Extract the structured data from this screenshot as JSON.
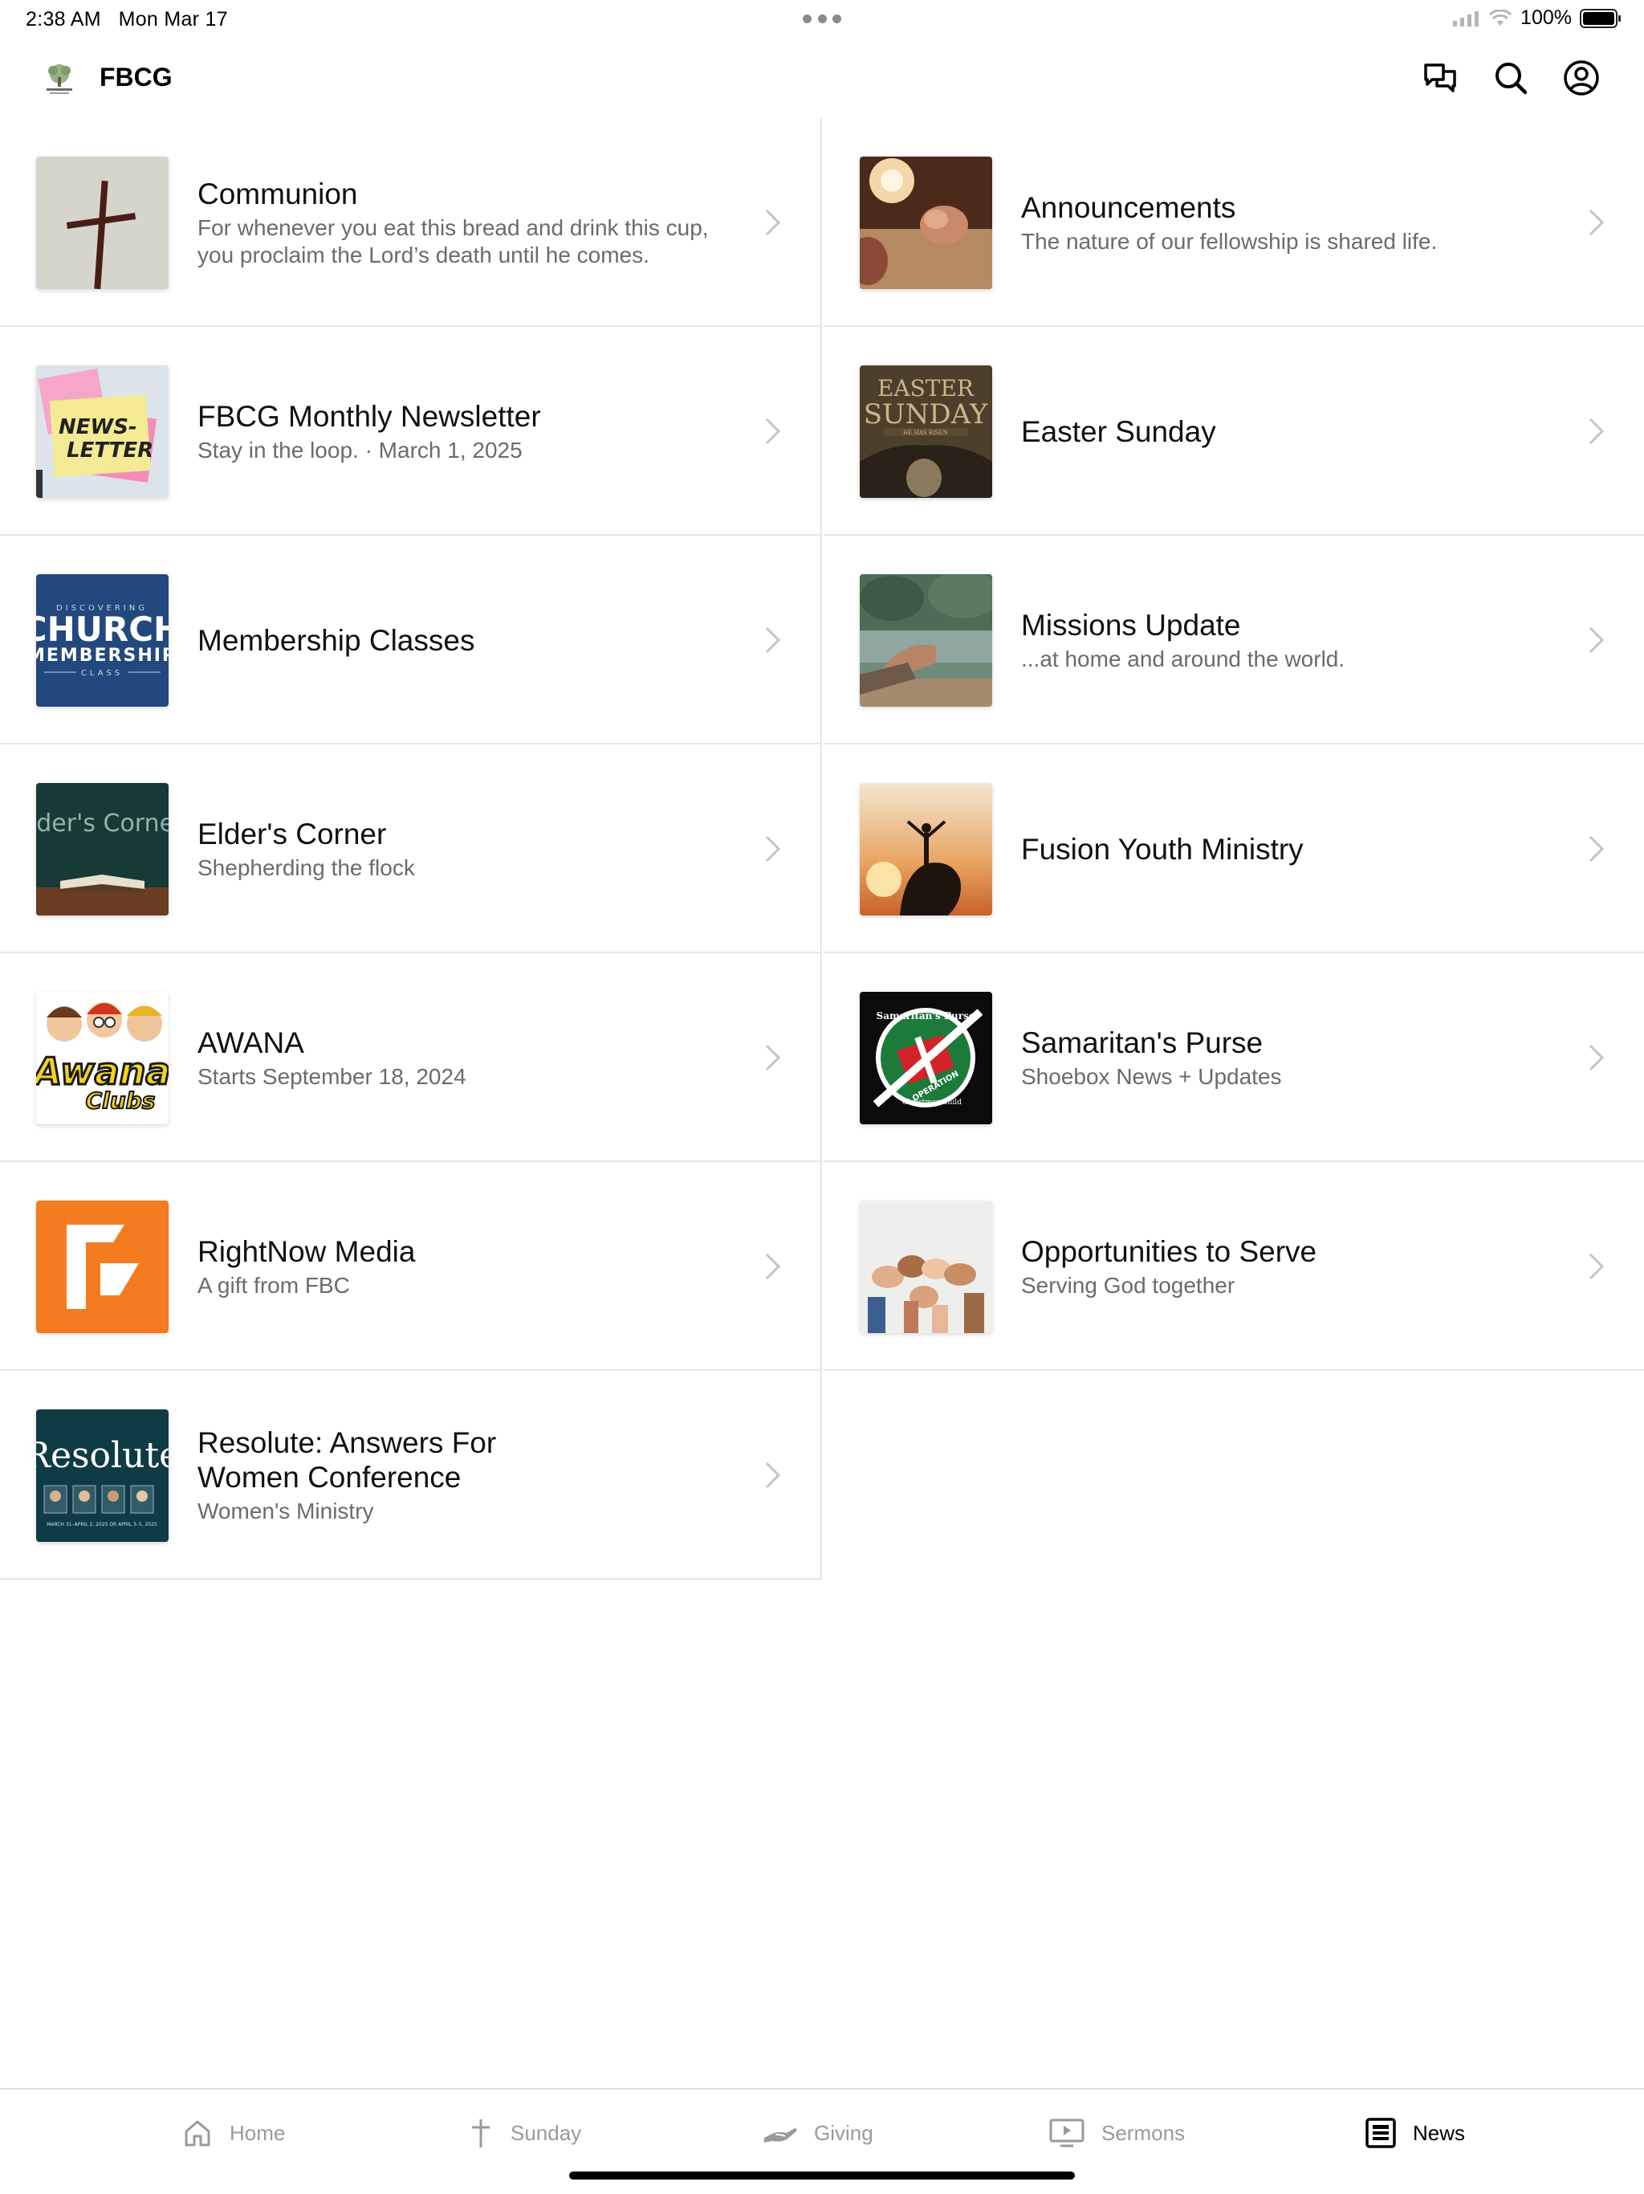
{
  "status_bar": {
    "time": "2:38 AM",
    "date": "Mon Mar 17",
    "battery": "100%",
    "icons": [
      "signal-icon",
      "wifi-icon",
      "battery-icon"
    ]
  },
  "header": {
    "title": "FBCG",
    "logo_icon": "church-logo-icon",
    "actions": [
      "chat-icon",
      "search-icon",
      "account-icon"
    ]
  },
  "news": {
    "items": [
      {
        "title": "Communion",
        "subtitle": "For whenever you eat this bread and drink this cup, you proclaim the Lord’s death until he comes.",
        "thumb": "cross-image"
      },
      {
        "title": "Announcements",
        "subtitle": "The nature of our fellowship is shared life.",
        "thumb": "praying-hands-image"
      },
      {
        "title": "FBCG Monthly Newsletter",
        "subtitle": "Stay in the loop. · March 1, 2025",
        "thumb": "newsletter-image",
        "thumb_text": "NEWS-\nLETTER"
      },
      {
        "title": "Easter Sunday",
        "subtitle": "",
        "thumb": "easter-sunday-image",
        "thumb_text": [
          "EASTER",
          "SUNDAY",
          "HE HAS RISEN"
        ]
      },
      {
        "title": "Membership Classes",
        "subtitle": "",
        "thumb": "membership-class-image",
        "thumb_text": [
          "DISCOVERING",
          "CHURCH",
          "MEMBERSHIP",
          "CLASS"
        ]
      },
      {
        "title": "Missions Update",
        "subtitle": "...at home and around the world.",
        "thumb": "missions-image"
      },
      {
        "title": "Elder's Corner",
        "subtitle": "Shepherding the flock",
        "thumb": "elders-corner-image",
        "thumb_text": "lder's Corne"
      },
      {
        "title": "Fusion Youth Ministry",
        "subtitle": "",
        "thumb": "youth-silhouette-image"
      },
      {
        "title": "AWANA",
        "subtitle": "Starts September 18, 2024",
        "thumb": "awana-clubs-image",
        "thumb_text": [
          "Awana",
          "Clubs"
        ]
      },
      {
        "title": "Samaritan's Purse",
        "subtitle": "Shoebox News + Updates",
        "thumb": "operation-christmas-child-image",
        "thumb_text": [
          "Samaritan's Purse",
          "OPERATION",
          "Christmas Child"
        ]
      },
      {
        "title": "RightNow Media",
        "subtitle": "A gift from FBC",
        "thumb": "rightnow-media-logo"
      },
      {
        "title": "Opportunities to Serve",
        "subtitle": "Serving God together",
        "thumb": "joined-hands-image"
      },
      {
        "title": "Resolute: Answers For Women Conference",
        "subtitle": "Women's Ministry",
        "thumb": "resolute-conference-image",
        "thumb_text": [
          "Resolute",
          "MARCH 31–APRIL 2, 2025 OR APRIL 3–5, 2025"
        ]
      }
    ]
  },
  "tab_bar": {
    "tabs": [
      {
        "label": "Home",
        "icon": "home-icon",
        "active": false
      },
      {
        "label": "Sunday",
        "icon": "cross-icon",
        "active": false
      },
      {
        "label": "Giving",
        "icon": "giving-hand-icon",
        "active": false
      },
      {
        "label": "Sermons",
        "icon": "video-screen-icon",
        "active": false
      },
      {
        "label": "News",
        "icon": "news-icon",
        "active": true
      }
    ]
  },
  "colors": {
    "accent": "#000000",
    "inactive": "#9a9a9a",
    "divider": "#e6e6e6",
    "rightnow_orange": "#f47b20"
  }
}
